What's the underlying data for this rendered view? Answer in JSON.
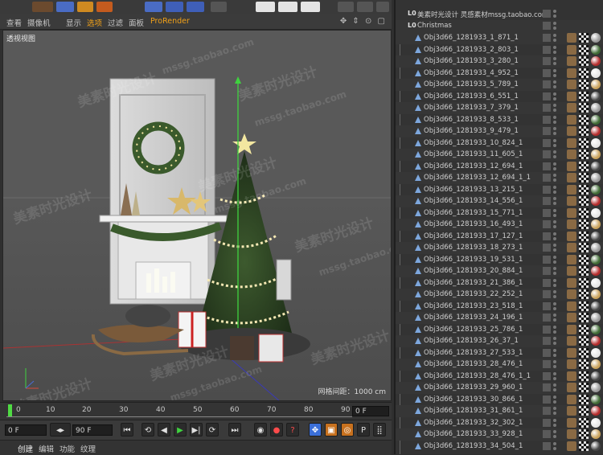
{
  "viewport": {
    "menu": [
      "查看",
      "摄像机",
      "显示",
      "选项",
      "过滤",
      "面板",
      "ProRender"
    ],
    "active_menu_index": 3,
    "view_label": "透视视图",
    "grid_readout": "网格间距：1000 cm",
    "nav_icons": "✥ ⇕ ⊙ ▢"
  },
  "watermarks": {
    "cn": "美素时光设计",
    "url": "mssg.taobao.com"
  },
  "timeline": {
    "ticks": [
      "0",
      "10",
      "20",
      "30",
      "40",
      "50",
      "60",
      "70",
      "80",
      "90"
    ],
    "current_frame_field": "0 F",
    "playhead_frame": 0
  },
  "transport": {
    "start_field": "0 F",
    "end_field": "90 F",
    "buttons": {
      "goto_start": "⏮",
      "prev_key": "⟲",
      "prev_frame": "◀",
      "play": "▶",
      "next_frame": "▶|",
      "next_key": "⟳",
      "goto_end": "⏭",
      "record": "◉",
      "auto_key": "●",
      "help": "?",
      "move": "✥",
      "scale": "▣",
      "rotate": "◎",
      "param": "P",
      "dots": "⣿"
    }
  },
  "bottom_tabs": [
    "创建",
    "编辑",
    "功能",
    "纹理"
  ],
  "object_manager": {
    "root_label": "美素时光设计 灵感素材mssg.taobao.com",
    "group_label": "Christmas",
    "level_badge": "L0",
    "objects": [
      "Obj3d66_1281933_1_871_1",
      "Obj3d66_1281933_2_803_1",
      "Obj3d66_1281933_3_280_1",
      "Obj3d66_1281933_4_952_1",
      "Obj3d66_1281933_5_789_1",
      "Obj3d66_1281933_6_551_1",
      "Obj3d66_1281933_7_379_1",
      "Obj3d66_1281933_8_533_1",
      "Obj3d66_1281933_9_479_1",
      "Obj3d66_1281933_10_824_1",
      "Obj3d66_1281933_11_605_1",
      "Obj3d66_1281933_12_694_1",
      "Obj3d66_1281933_12_694_1_1",
      "Obj3d66_1281933_13_215_1",
      "Obj3d66_1281933_14_556_1",
      "Obj3d66_1281933_15_771_1",
      "Obj3d66_1281933_16_493_1",
      "Obj3d66_1281933_17_127_1",
      "Obj3d66_1281933_18_273_1",
      "Obj3d66_1281933_19_531_1",
      "Obj3d66_1281933_20_884_1",
      "Obj3d66_1281933_21_386_1",
      "Obj3d66_1281933_22_252_1",
      "Obj3d66_1281933_23_518_1",
      "Obj3d66_1281933_24_196_1",
      "Obj3d66_1281933_25_786_1",
      "Obj3d66_1281933_26_37_1",
      "Obj3d66_1281933_27_533_1",
      "Obj3d66_1281933_28_476_1",
      "Obj3d66_1281933_28_476_1_1",
      "Obj3d66_1281933_29_960_1",
      "Obj3d66_1281933_30_866_1",
      "Obj3d66_1281933_31_861_1",
      "Obj3d66_1281933_32_302_1",
      "Obj3d66_1281933_33_928_1",
      "Obj3d66_1281933_34_504_1"
    ],
    "material_tags": [
      "wood",
      "checker",
      "sphere-gray",
      "sphere-green",
      "sphere-red",
      "sphere-white",
      "sphere-gold",
      "sphere-dark"
    ]
  },
  "colors": {
    "accent_orange": "#f0a018",
    "playhead_green": "#4fdb43",
    "axis_y": "#3fd23f",
    "axis_x": "#d84a3a",
    "axis_z": "#4a6ad8"
  }
}
